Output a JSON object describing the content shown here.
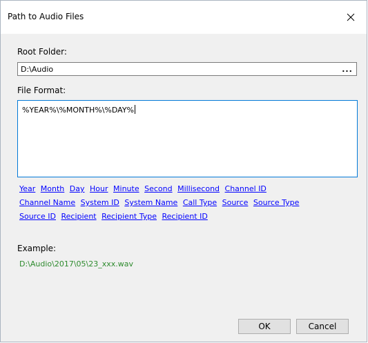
{
  "window": {
    "title": "Path to Audio Files",
    "close_icon": "close-icon"
  },
  "root_folder": {
    "label": "Root Folder:",
    "value": "D:\\Audio",
    "browse_label": "..."
  },
  "file_format": {
    "label": "File Format:",
    "value": "%YEAR%\\%MONTH%\\%DAY%"
  },
  "tokens": {
    "row1": [
      "Year",
      "Month",
      "Day",
      "Hour",
      "Minute",
      "Second",
      "Millisecond",
      "Channel ID"
    ],
    "row2": [
      "Channel Name",
      "System ID",
      "System Name",
      "Call Type",
      "Source",
      "Source Type"
    ],
    "row3": [
      "Source ID",
      "Recipient",
      "Recipient Type",
      "Recipient ID"
    ]
  },
  "example": {
    "label": "Example:",
    "value": "D:\\Audio\\2017\\05\\23_xxx.wav"
  },
  "buttons": {
    "ok": "OK",
    "cancel": "Cancel"
  },
  "colors": {
    "link": "#0000ff",
    "example": "#2e8b2e",
    "focus_border": "#0078d7"
  }
}
